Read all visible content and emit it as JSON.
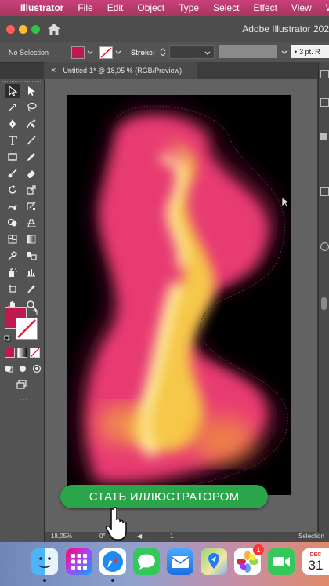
{
  "menubar": {
    "app_name": "Illustrator",
    "items": [
      "File",
      "Edit",
      "Object",
      "Type",
      "Select",
      "Effect",
      "View",
      "W"
    ]
  },
  "window": {
    "title": "Adobe Illustrator 202"
  },
  "control_bar": {
    "selection_label": "No Selection",
    "fill_color": "#c0194e",
    "stroke_label": "Stroke:",
    "stroke_profile": "3 pt. R"
  },
  "document": {
    "tab_title": "Untitled-1* @ 18,05 % (RGB/Preview)",
    "close_glyph": "×"
  },
  "status_bar": {
    "zoom": "18,05%",
    "rotation": "0°",
    "artboard_number": "1",
    "mode": "Selection"
  },
  "cta": {
    "label": "СТАТЬ ИЛЛЮСТРАТОРОМ"
  },
  "dock": {
    "mail_badge": "1",
    "calendar_month": "DEC",
    "calendar_day": "31"
  },
  "colors": {
    "accent_pink": "#c0194e",
    "cta_green": "#2aa54a",
    "menubar_gradient": "#b83a6c"
  }
}
